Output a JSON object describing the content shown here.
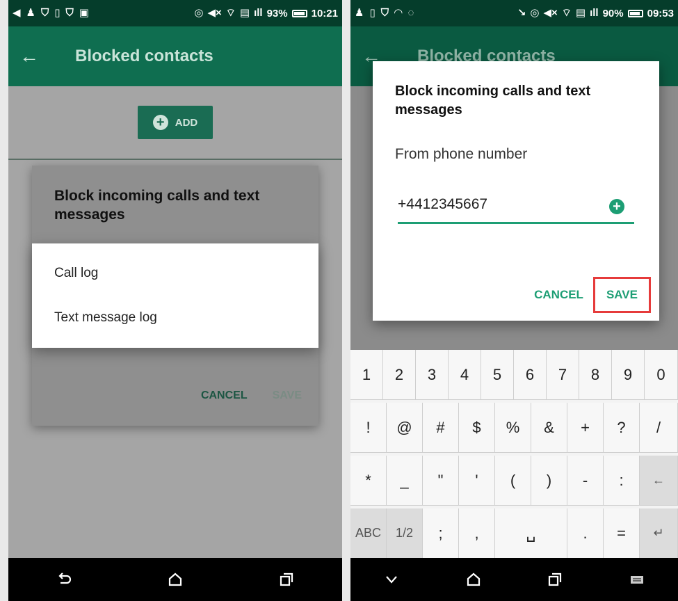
{
  "left": {
    "status": {
      "battery": "93%",
      "time": "10:21"
    },
    "appbar": {
      "title": "Blocked contacts"
    },
    "add_label": "ADD",
    "dialog": {
      "title": "Block incoming calls and text messages",
      "cancel": "CANCEL",
      "save": "SAVE"
    },
    "menu": [
      {
        "label": "Call log"
      },
      {
        "label": "Text message log"
      }
    ]
  },
  "right": {
    "status": {
      "battery": "90%",
      "time": "09:53"
    },
    "appbar": {
      "title": "Blocked contacts"
    },
    "dialog": {
      "title": "Block incoming calls and text messages",
      "subtitle": "From phone number",
      "phone_value": "+4412345667",
      "cancel": "CANCEL",
      "save": "SAVE"
    },
    "keyboard": {
      "row1": [
        "1",
        "2",
        "3",
        "4",
        "5",
        "6",
        "7",
        "8",
        "9",
        "0"
      ],
      "row2": [
        "!",
        "@",
        "#",
        "$",
        "%",
        "&",
        "+",
        "?",
        "/"
      ],
      "row3": [
        "*",
        "_",
        "\"",
        "'",
        "(",
        ")",
        "-",
        ":",
        "←"
      ],
      "row4": [
        "ABC",
        "1/2",
        ";",
        ",",
        "␣",
        ".",
        "=",
        "↵"
      ]
    }
  },
  "colors": {
    "accent": "#1d9e74",
    "appbar": "#0f6e50",
    "statusbar": "#053d2b",
    "highlight": "#e63b3b"
  }
}
